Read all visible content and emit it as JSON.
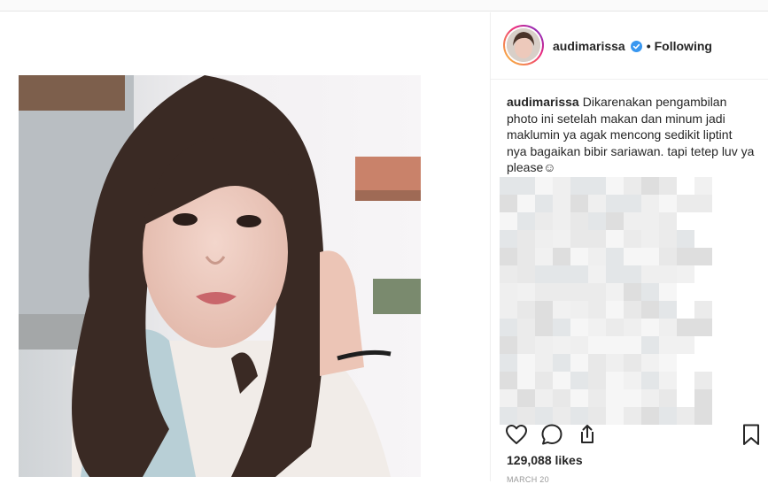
{
  "post": {
    "author": "audimarissa",
    "follow_status": "Following",
    "caption_username": "audimarissa",
    "caption_text": "Dikarenakan pengambilan photo ini setelah makan dan minum jadi maklumin ya agak mencong sedikit liptint nya bagaikan bibir sariawan. tapi tetep luv ya please☺",
    "likes": "129,088 likes",
    "date": "MARCH 20"
  },
  "icons": {
    "verified": "verified-badge-icon",
    "like": "heart-icon",
    "comment": "comment-icon",
    "share": "share-icon",
    "save": "bookmark-icon"
  },
  "colors": {
    "verified_blue": "#3897f0",
    "text": "#262626",
    "muted": "#999999",
    "border": "#efefef"
  }
}
